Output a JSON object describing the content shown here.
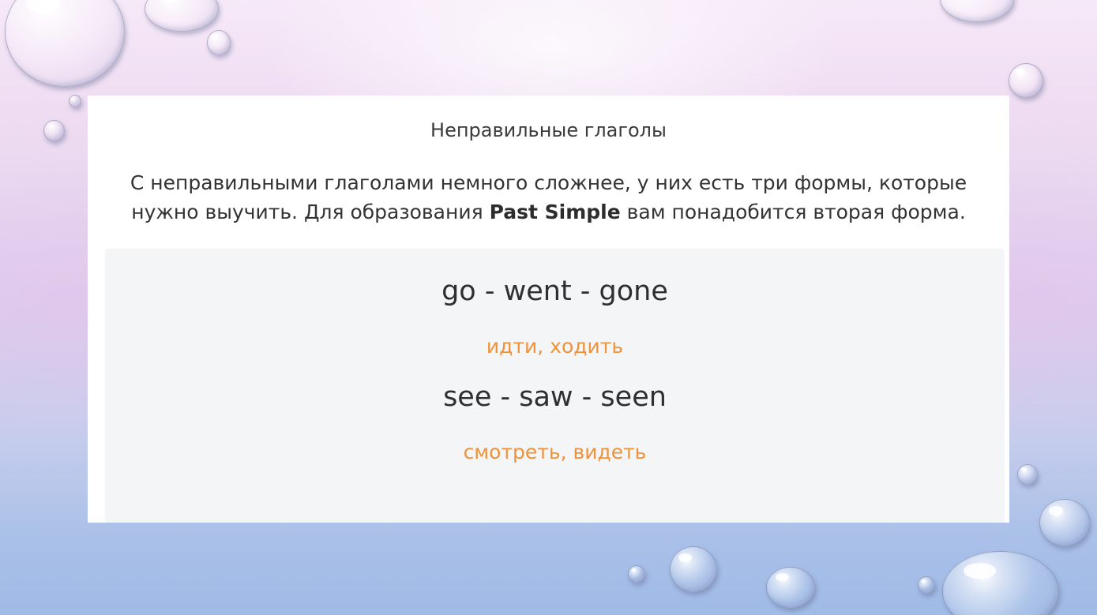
{
  "slide": {
    "title": "Неправильные глаголы",
    "intro_before": "С неправильными глаголами немного сложнее, у них есть три формы, которые нужно выучить. Для образования ",
    "intro_bold": "Past Simple",
    "intro_after": " вам понадобится вторая форма.",
    "verbs": [
      {
        "forms": "go - went - gone",
        "translation": "идти, ходить"
      },
      {
        "forms": "see - saw - seen",
        "translation": "смотреть, видеть"
      }
    ]
  },
  "colors": {
    "translation": "#f0923a",
    "verb_box_bg": "#f4f5f7"
  }
}
